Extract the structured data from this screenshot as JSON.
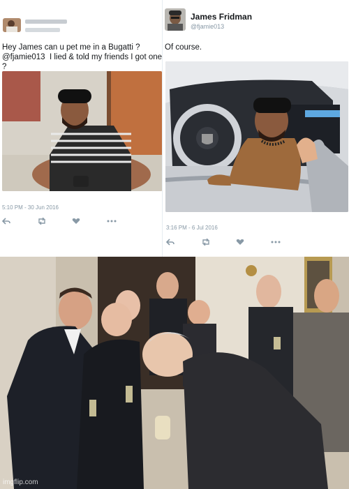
{
  "left_tweet": {
    "name_redacted": "",
    "handle_redacted": "",
    "text_line1": "Hey James can u pet me in a Bugatti ?",
    "mention": "@fjamie013",
    "text_line2_rest": "I lied & told my friends I got one ?",
    "timestamp": "5:10 PM - 30 Jun 2016",
    "actions": [
      "reply-icon",
      "retweet-icon",
      "like-icon",
      "more-icon"
    ]
  },
  "right_tweet": {
    "name": "James Fridman",
    "handle": "@fjamie013",
    "text": "Of course.",
    "timestamp": "3:16 PM - 6 Jul 2016",
    "actions": [
      "reply-icon",
      "retweet-icon",
      "like-icon",
      "more-icon"
    ]
  },
  "meme": {
    "watermark": "imgflip.com"
  },
  "colors": {
    "text": "#14171a",
    "muted": "#8899a6",
    "divider": "#e6ecf0"
  }
}
